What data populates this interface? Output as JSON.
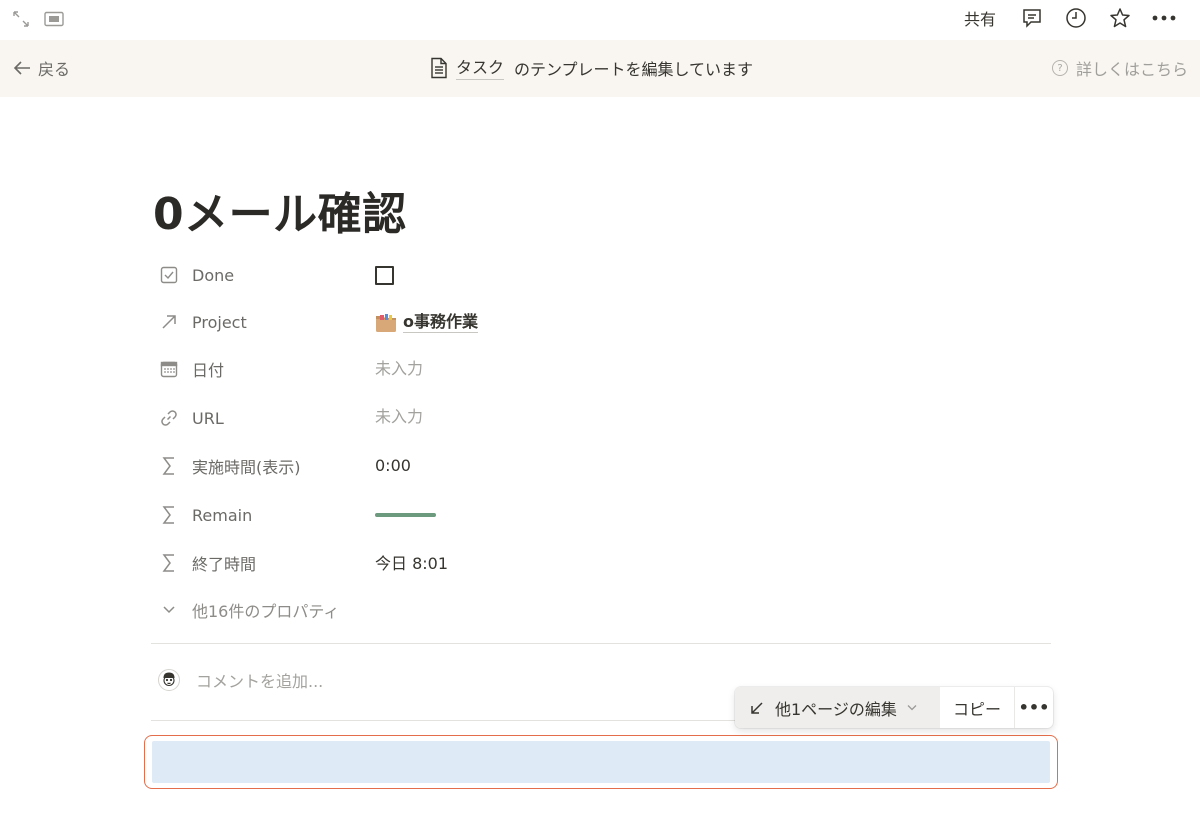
{
  "topbar": {
    "expand_icon": "expand-diagonal-icon",
    "sidebar_icon": "panel-icon",
    "share_label": "共有",
    "comment_icon": "comment-icon",
    "history_icon": "clock-icon",
    "favorite_icon": "star-icon",
    "more_icon": "ellipsis-icon"
  },
  "banner": {
    "back_label": "戻る",
    "template_name": "タスク",
    "template_suffix": "のテンプレートを編集しています",
    "help_label": "詳しくはこちら"
  },
  "page": {
    "title": "0メール確認"
  },
  "properties": [
    {
      "icon": "checkbox-icon",
      "name": "Done",
      "value": "",
      "type": "checkbox",
      "checked": false
    },
    {
      "icon": "relation-arrow-icon",
      "name": "Project",
      "value": "o事務作業",
      "type": "relation",
      "emoji": "folder-icon"
    },
    {
      "icon": "calendar-icon",
      "name": "日付",
      "value": "未入力",
      "type": "empty"
    },
    {
      "icon": "link-icon",
      "name": "URL",
      "value": "未入力",
      "type": "empty"
    },
    {
      "icon": "sigma-icon",
      "name": "実施時間(表示)",
      "value": "0:00",
      "type": "text"
    },
    {
      "icon": "sigma-icon",
      "name": "Remain",
      "value": "",
      "type": "bar",
      "bar_color": "#6c9a7e"
    },
    {
      "icon": "sigma-icon",
      "name": "終了時間",
      "value": "今日 8:01",
      "type": "text"
    }
  ],
  "more_properties_label": "他16件のプロパティ",
  "comment": {
    "placeholder": "コメントを追加..."
  },
  "block_toolbar": {
    "edit_label": "他1ページの編集",
    "copy_label": "コピー",
    "more_label": "•••"
  },
  "colors": {
    "banner_bg": "#f9f6f1",
    "selection_border": "#e46e4c",
    "selection_fill": "#dfeaf7"
  }
}
